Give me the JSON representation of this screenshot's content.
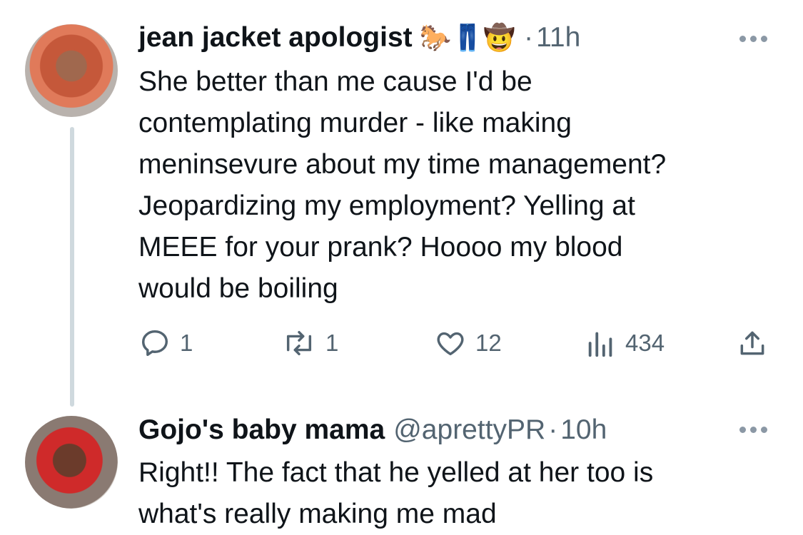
{
  "tweet1": {
    "name": "jean jacket apologist",
    "emojis": "🐎👖🤠",
    "dot": "·",
    "time": "11h",
    "lines": [
      "She better than me cause I'd be",
      "contemplating murder - like making",
      "meninsevure about my time management?",
      "Jeopardizing my employment? Yelling at",
      "MEEE for your prank? Hoooo my blood",
      "would be boiling"
    ],
    "actions": {
      "replies": "1",
      "retweets": "1",
      "likes": "12",
      "views": "434"
    },
    "icons": [
      "reply-icon",
      "retweet-icon",
      "like-icon",
      "views-icon",
      "share-icon"
    ]
  },
  "tweet2": {
    "name": "Gojo's baby mama",
    "handle": "@aprettyPR",
    "dot": "·",
    "time": "10h",
    "lines": [
      "Right!! The fact that he yelled at her too is",
      "what's really making me mad"
    ]
  },
  "colors": {
    "text": "#0f1419",
    "muted": "#536471",
    "thread_line": "#cfd9de"
  }
}
